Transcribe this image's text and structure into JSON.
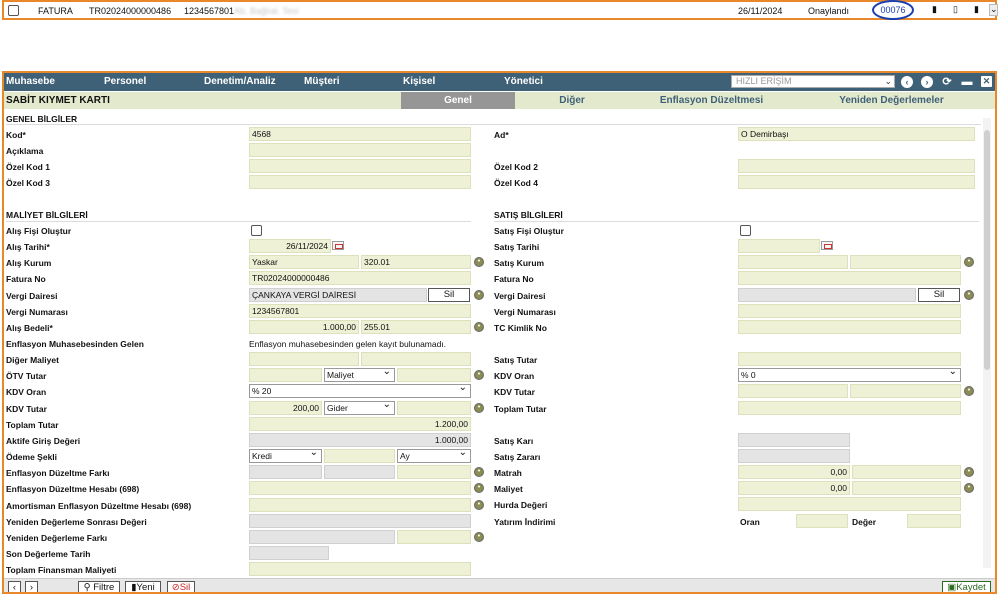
{
  "top_row": {
    "type": "FATURA",
    "invoice_no": "TR02024000000486",
    "tax_no": "1234567801",
    "company_blur": "Ab. Bağlıal. Tesi",
    "date": "26/11/2024",
    "status": "Onaylandı",
    "number": "00076"
  },
  "menu": {
    "items": [
      "Muhasebe",
      "Personel",
      "Denetim/Analiz",
      "Müşteri",
      "Kişisel",
      "Yönetici"
    ],
    "quick_access": "HIZLI ERİŞİM"
  },
  "page": {
    "title": "SABİT KIYMET KARTI",
    "tabs": [
      "Genel",
      "Diğer",
      "Enflasyon Düzeltmesi",
      "Yeniden Değerlemeler"
    ]
  },
  "general": {
    "section": "GENEL BİLGİLER",
    "kod_label": "Kod*",
    "kod_value": "4568",
    "ad_label": "Ad*",
    "ad_value": "O Demirbaşı",
    "aciklama_label": "Açıklama",
    "ozel1_label": "Özel Kod 1",
    "ozel2_label": "Özel Kod 2",
    "ozel3_label": "Özel Kod 3",
    "ozel4_label": "Özel Kod 4"
  },
  "maliyet": {
    "section": "MALİYET BİLGİLERİ",
    "alis_fisi_label": "Alış Fişi Oluştur",
    "alis_tarihi_label": "Alış Tarihi*",
    "alis_tarihi_value": "26/11/2024",
    "alis_kurum_label": "Alış Kurum",
    "alis_kurum_name": "Yaskar",
    "alis_kurum_code": "320.01",
    "fatura_no_label": "Fatura No",
    "fatura_no_value": "TR02024000000486",
    "vergi_dairesi_label": "Vergi Dairesi",
    "vergi_dairesi_value": "ÇANKAYA VERGİ DAİRESİ",
    "sil_label": "Sil",
    "vergi_no_label": "Vergi Numarası",
    "vergi_no_value": "1234567801",
    "alis_bedeli_label": "Alış Bedeli*",
    "alis_bedeli_value": "1.000,00",
    "alis_bedeli_code": "255.01",
    "enf_muh_label": "Enflasyon Muhasebesinden Gelen",
    "enf_muh_value": "Enflasyon muhasebesinden gelen kayıt bulunamadı.",
    "diger_maliyet_label": "Diğer Maliyet",
    "otv_label": "ÖTV Tutar",
    "otv_select": "Maliyet",
    "kdv_oran_label": "KDV Oran",
    "kdv_oran_value": "% 20",
    "kdv_tutar_label": "KDV Tutar",
    "kdv_tutar_value": "200,00",
    "kdv_tutar_select": "Gider",
    "toplam_tutar_label": "Toplam Tutar",
    "toplam_tutar_value": "1.200,00",
    "aktife_label": "Aktife Giriş Değeri",
    "aktife_value": "1.000,00",
    "odeme_label": "Ödeme Şekli",
    "odeme_value": "Kredi",
    "odeme_period": "Ay",
    "enf_fark_label": "Enflasyon Düzeltme Farkı",
    "enf_hesap_label": "Enflasyon Düzeltme Hesabı (698)",
    "amort_label": "Amortisman Enflasyon Düzeltme Hesabı (698)",
    "yd_sonrasi_label": "Yeniden Değerleme Sonrası Değeri",
    "yd_fark_label": "Yeniden Değerleme Farkı",
    "son_deger_label": "Son Değerleme Tarih",
    "toplam_fin_label": "Toplam Finansman Maliyeti"
  },
  "satis": {
    "section": "SATIŞ BİLGİLERİ",
    "satis_fisi_label": "Satış Fişi Oluştur",
    "satis_tarihi_label": "Satış Tarihi",
    "satis_kurum_label": "Satış Kurum",
    "fatura_no_label": "Fatura No",
    "vergi_dairesi_label": "Vergi Dairesi",
    "sil_label": "Sil",
    "vergi_no_label": "Vergi Numarası",
    "tc_label": "TC Kimlik No",
    "satis_tutar_label": "Satış Tutar",
    "kdv_oran_label": "KDV Oran",
    "kdv_oran_value": "% 0",
    "kdv_tutar_label": "KDV Tutar",
    "toplam_tutar_label": "Toplam Tutar",
    "satis_kari_label": "Satış Karı",
    "satis_zarari_label": "Satış Zararı",
    "matrah_label": "Matrah",
    "matrah_value": "0,00",
    "maliyet_label": "Maliyet",
    "maliyet_value": "0,00",
    "hurda_label": "Hurda Değeri",
    "yatirim_label": "Yatırım İndirimi",
    "oran_label": "Oran",
    "deger_label": "Değer"
  },
  "bottom": {
    "filtre": "Filtre",
    "yeni": "Yeni",
    "sil": "Sil",
    "kaydet": "Kaydet"
  },
  "colors": {
    "menu_bg": "#3f6178",
    "field_bg": "#eef1d5",
    "accent_border": "#e8882a",
    "circle": "#1a3fb0"
  }
}
